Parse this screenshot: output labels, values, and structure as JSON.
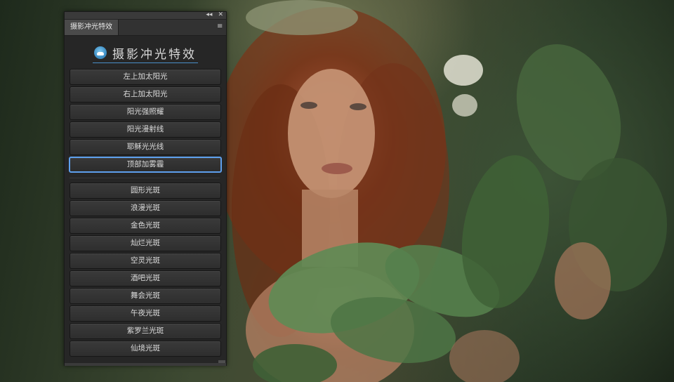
{
  "panel": {
    "tab_label": "摄影冲光特效",
    "collapse_glyph": "◂◂",
    "close_glyph": "✕",
    "menu_glyph": "≡",
    "brand_title": "摄影冲光特效",
    "accent_color": "#5ea0ee",
    "buttons_group1": [
      "左上加太阳光",
      "右上加太阳光",
      "阳光强照耀",
      "阳光漫射线",
      "耶稣光光线",
      "顶部加雾霾"
    ],
    "active_button": "顶部加雾霾",
    "buttons_group2": [
      "圆形光斑",
      "浪漫光斑",
      "金色光斑",
      "灿烂光斑",
      "空灵光斑",
      "酒吧光斑",
      "舞会光斑",
      "午夜光斑",
      "紫罗兰光斑",
      "仙境光斑"
    ]
  },
  "background_photo": {
    "subject": "red-haired woman with floral crown among green leaves"
  }
}
